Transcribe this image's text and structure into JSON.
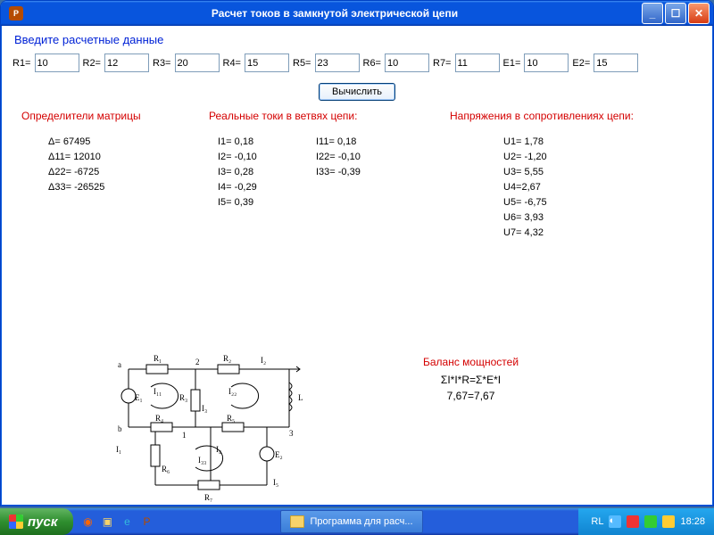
{
  "window": {
    "title": "Расчет токов в замкнутой электрической цепи"
  },
  "header": "Введите  расчетные данные",
  "inputs": {
    "r1": {
      "label": "R1=",
      "value": "10"
    },
    "r2": {
      "label": "R2=",
      "value": "12"
    },
    "r3": {
      "label": "R3=",
      "value": "20"
    },
    "r4": {
      "label": "R4=",
      "value": "15"
    },
    "r5": {
      "label": "R5=",
      "value": "23"
    },
    "r6": {
      "label": "R6=",
      "value": "10"
    },
    "r7": {
      "label": "R7=",
      "value": "11"
    },
    "e1": {
      "label": "E1=",
      "value": "10"
    },
    "e2": {
      "label": "E2=",
      "value": "15"
    }
  },
  "calc_label": "Вычислить",
  "determinants": {
    "title": "Определители матрицы",
    "rows": [
      "Δ= 67495",
      "Δ11= 12010",
      "Δ22= -6725",
      "Δ33= -26525"
    ]
  },
  "currents": {
    "title": "Реальные токи в ветвях цепи:",
    "col_a": [
      "I1= 0,18",
      "I2= -0,10",
      "I3= 0,28",
      "I4= -0,29",
      "I5= 0,39"
    ],
    "col_b": [
      "I11= 0,18",
      "I22= -0,10",
      "I33= -0,39"
    ]
  },
  "voltages": {
    "title": "Напряжения в сопротивлениях цепи:",
    "rows": [
      "U1= 1,78",
      "U2= -1,20",
      "U3= 5,55",
      "U4=2,67",
      "U5= -6,75",
      "U6= 3,93",
      "U7= 4,32"
    ]
  },
  "power": {
    "title": "Баланс мощностей",
    "formula": "ΣI*I*R=Σ*E*I",
    "result": "7,67=7,67"
  },
  "diagram": {
    "labels": {
      "a": "a",
      "b": "b",
      "n2": "2",
      "n1": "1",
      "n3": "3",
      "R1": "R₁",
      "R2": "R₂",
      "R3": "R₃",
      "R4": "R₄",
      "R5": "R₅",
      "R6": "R₆",
      "R7": "R₇",
      "E1": "E₁",
      "E2": "E₂",
      "L": "L",
      "I1": "I₁",
      "I2": "I₂",
      "I3": "I₃",
      "I4": "I₄",
      "I5": "I₅",
      "I11": "I₁₁",
      "I22": "I₂₂",
      "I33": "I₃₃"
    }
  },
  "taskbar": {
    "start": "пуск",
    "task": "Программа для расч...",
    "lang": "RL",
    "clock": "18:28"
  }
}
